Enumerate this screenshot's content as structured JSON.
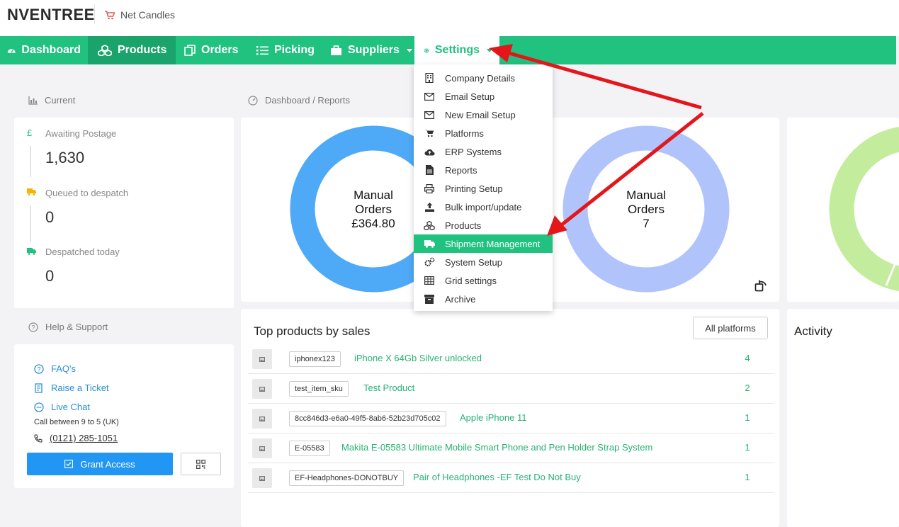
{
  "header": {
    "logo": "NVENTREE",
    "store": "Net Candles"
  },
  "nav": {
    "dashboard": "Dashboard",
    "products": "Products",
    "orders": "Orders",
    "picking": "Picking",
    "suppliers": "Suppliers",
    "settings": "Settings"
  },
  "current": {
    "heading": "Current",
    "awaiting_label": "Awaiting Postage",
    "awaiting_value": "1,630",
    "queued_label": "Queued to despatch",
    "queued_value": "0",
    "despatched_label": "Despatched today",
    "despatched_value": "0"
  },
  "help": {
    "heading": "Help & Support",
    "faq": "FAQ's",
    "ticket": "Raise a Ticket",
    "chat": "Live Chat",
    "call_hours": "Call between 9 to 5 (UK)",
    "phone": "(0121) 285-1051",
    "grant": "Grant Access"
  },
  "reports": {
    "heading": "Dashboard / Reports",
    "donut1": {
      "line1": "Manual",
      "line2": "Orders",
      "value": "£364.80",
      "color": "#4ea9f7"
    },
    "donut2": {
      "line1": "Manual",
      "line2": "Orders",
      "value": "7",
      "color": "#b0c4fb"
    },
    "donut3": {
      "color": "#c3ec9c"
    }
  },
  "top_products": {
    "title": "Top products by sales",
    "filter": "All platforms",
    "rows": [
      {
        "sku": "iphonex123",
        "name": "iPhone X 64Gb Silver unlocked",
        "qty": "4"
      },
      {
        "sku": "test_item_sku",
        "name": "Test Product",
        "qty": "2"
      },
      {
        "sku": "8cc846d3-e6a0-49f5-8ab6-52b23d705c02",
        "name": "Apple iPhone 11",
        "qty": "1"
      },
      {
        "sku": "E-05583",
        "name": "Makita E-05583 Ultimate Mobile Smart Phone and Pen Holder Strap System",
        "qty": "1"
      },
      {
        "sku": "EF-Headphones-DONOTBUY",
        "name": "Pair of Headphones -EF Test Do Not Buy",
        "qty": "1"
      }
    ]
  },
  "activity": {
    "title": "Activity"
  },
  "settings_menu": {
    "items": [
      {
        "label": "Company Details",
        "icon": "building-icon"
      },
      {
        "label": "Email Setup",
        "icon": "envelope-icon"
      },
      {
        "label": "New Email Setup",
        "icon": "envelope-icon"
      },
      {
        "label": "Platforms",
        "icon": "cart-icon"
      },
      {
        "label": "ERP Systems",
        "icon": "cloud-upload-icon"
      },
      {
        "label": "Reports",
        "icon": "file-icon"
      },
      {
        "label": "Printing Setup",
        "icon": "printer-icon"
      },
      {
        "label": "Bulk import/update",
        "icon": "upload-icon"
      },
      {
        "label": "Products",
        "icon": "cubes-icon"
      },
      {
        "label": "Shipment Management",
        "icon": "truck-icon",
        "highlighted": true
      },
      {
        "label": "System Setup",
        "icon": "cogs-icon"
      },
      {
        "label": "Grid settings",
        "icon": "table-icon"
      },
      {
        "label": "Archive",
        "icon": "archive-icon"
      }
    ]
  },
  "colors": {
    "brand_green": "#21c17f",
    "arrow_red": "#e3161b",
    "link_blue": "#2a8fd6"
  }
}
